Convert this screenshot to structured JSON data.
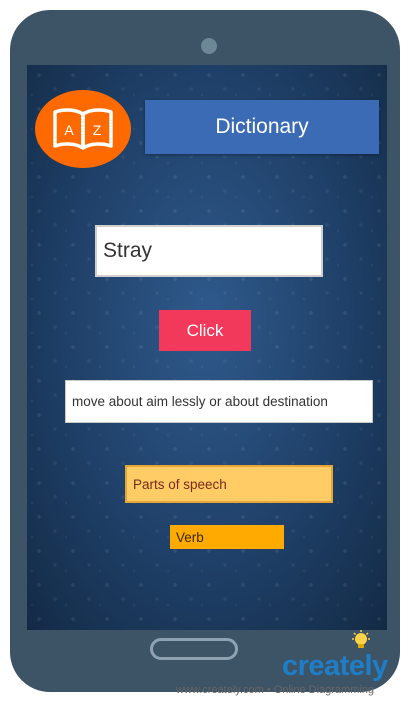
{
  "app": {
    "title": "Dictionary",
    "logo_letters": [
      "A",
      "Z"
    ]
  },
  "search": {
    "value": "Stray"
  },
  "action": {
    "click_label": "Click"
  },
  "result": {
    "meaning": "move about aim lessly or about destination",
    "parts_of_speech_label": "Parts of speech",
    "parts_of_speech_value": "Verb"
  },
  "watermark": {
    "brand": "creately",
    "footer": "www.creately.com • Online Diagramming"
  },
  "colors": {
    "phone_body": "#3d5366",
    "logo_orange": "#ff6a00",
    "title_blue": "#3b6bb5",
    "button_red": "#f2395b",
    "pos_label_bg": "#ffcc66",
    "pos_value_bg": "#ffaa00",
    "brand_blue": "#1e7fc8"
  }
}
